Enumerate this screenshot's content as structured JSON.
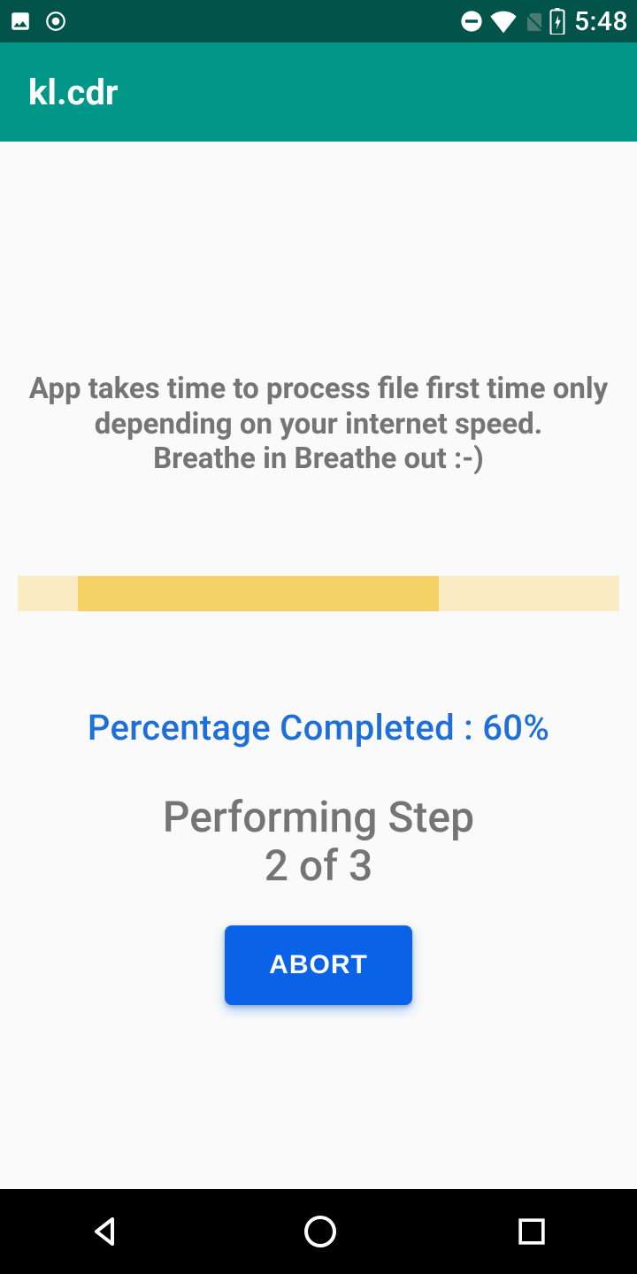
{
  "status": {
    "time": "5:48"
  },
  "app": {
    "title": "kl.cdr"
  },
  "content": {
    "info_line1": "App takes time to process file first time only",
    "info_line2": "depending on your internet speed.",
    "info_line3": "Breathe in Breathe out :-)",
    "progress": {
      "percent": 60,
      "indeterminate_offset_pct": 10,
      "indeterminate_width_pct": 60
    },
    "percent_label": "Percentage Completed : 60%",
    "step_line1": "Performing Step",
    "step_line2": "2 of 3",
    "abort_label": "ABORT"
  }
}
